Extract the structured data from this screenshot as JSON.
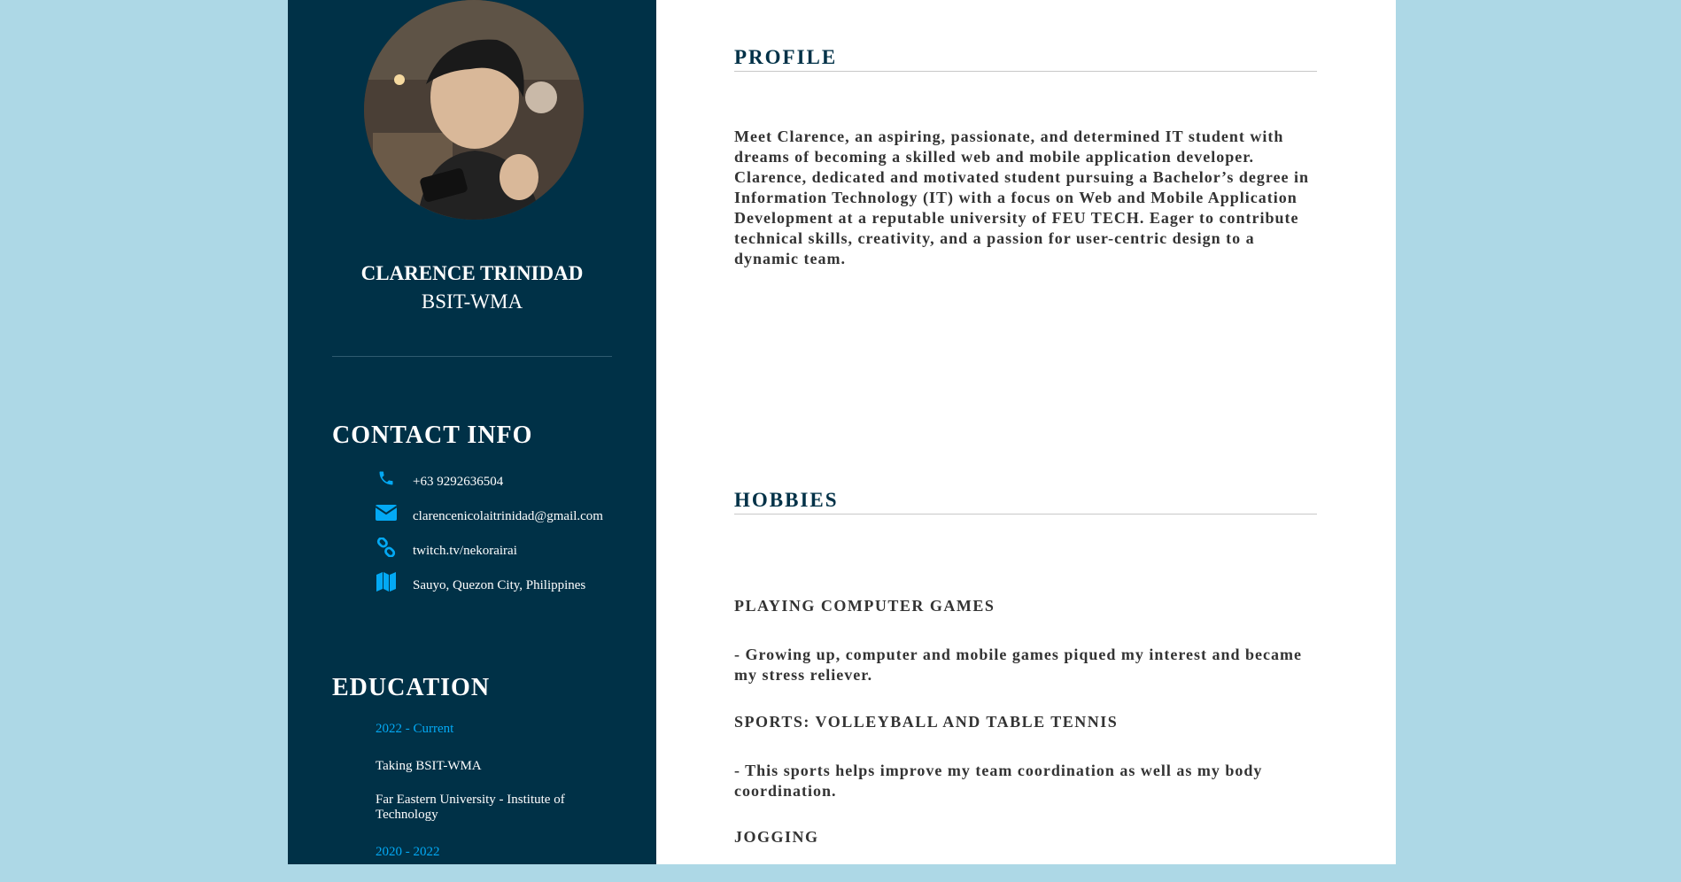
{
  "sidebar": {
    "name": "CLARENCE TRINIDAD",
    "role": "BSIT-WMA",
    "contact_title": "CONTACT INFO",
    "contacts": [
      {
        "icon": "phone-icon",
        "text": "+63 9292636504"
      },
      {
        "icon": "envelope-icon",
        "text": "clarencenicolaitrinidad@gmail.com"
      },
      {
        "icon": "link-icon",
        "text": "twitch.tv/nekorairai"
      },
      {
        "icon": "map-icon",
        "text": "Sauyo, Quezon City, Philippines"
      }
    ],
    "education_title": "EDUCATION",
    "education": [
      {
        "year": "2022 - Current",
        "degree": "Taking BSIT-WMA",
        "school": "Far Eastern University - Institute of Technology"
      },
      {
        "year": "2020 - 2022"
      }
    ],
    "accent": "#03a9f4",
    "bg": "#003147"
  },
  "main": {
    "profile_title": "PROFILE",
    "profile_text": "Meet Clarence, an aspiring, passionate, and determined IT student with dreams of becoming a skilled web and mobile application developer. Clarence, dedicated and motivated student pursuing a Bachelor’s degree in Information Technology (IT) with a focus on Web and Mobile Application Development at a reputable university of FEU TECH. Eager to contribute technical skills, creativity, and a passion for user-centric design to a dynamic team.",
    "hobbies_title": "HOBBIES",
    "hobbies": [
      {
        "title": "PLAYING COMPUTER GAMES",
        "desc": "- Growing up, computer and mobile games piqued my interest and became my stress reliever."
      },
      {
        "title": "SPORTS: VOLLEYBALL AND TABLE TENNIS",
        "desc": "- This sports helps improve my team coordination as well as my body coordination."
      },
      {
        "title": "JOGGING"
      }
    ]
  },
  "page_bg": "#add8e6"
}
